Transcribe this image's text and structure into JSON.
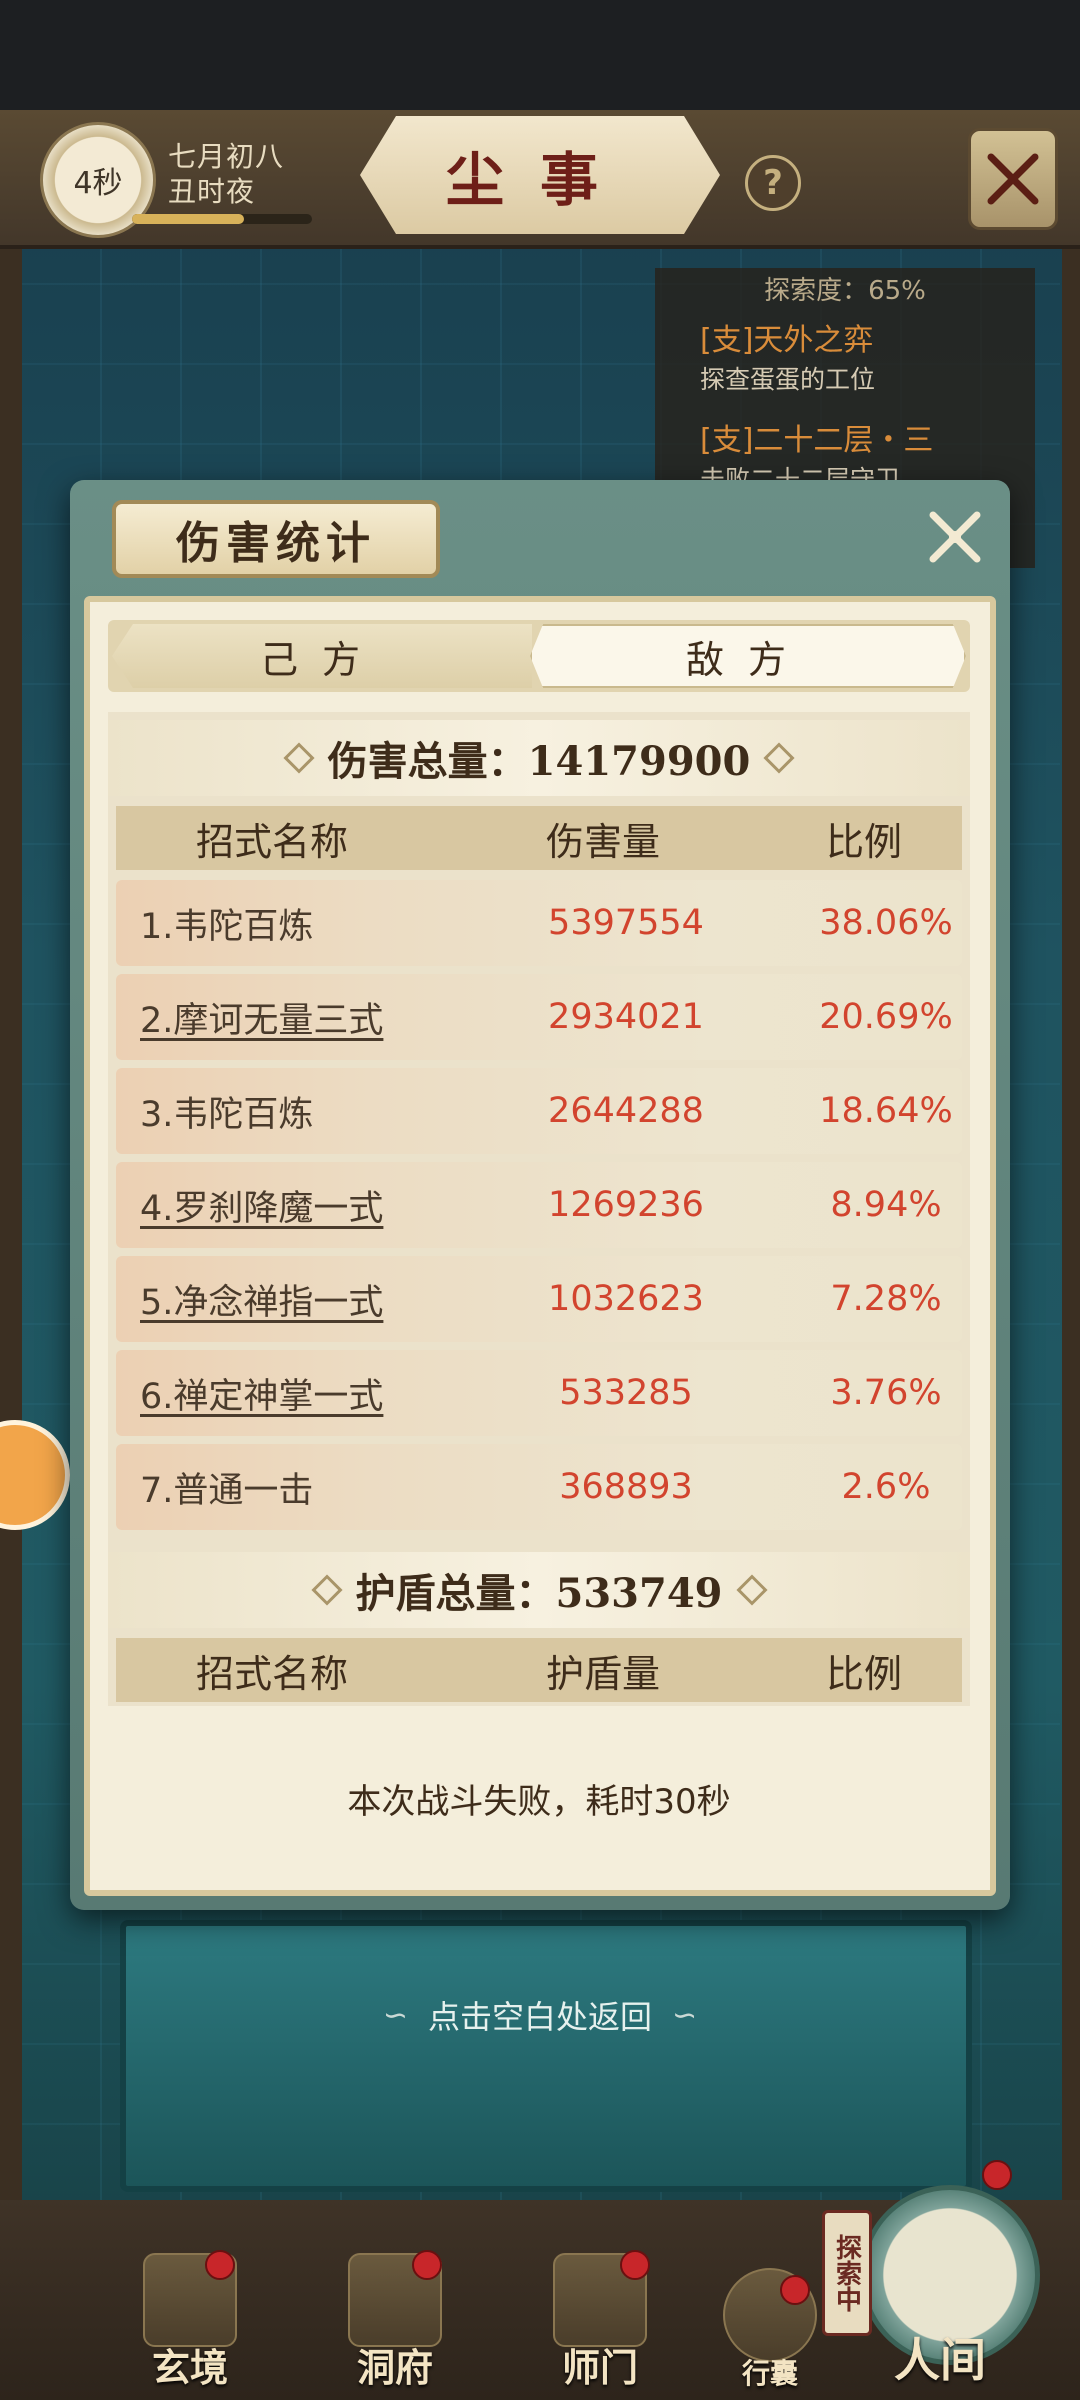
{
  "top_bar": {
    "timer": "4秒",
    "date_line1": "七月初八",
    "date_line2": "丑时夜",
    "progress": 0.62,
    "title": "尘事",
    "help_label": "?"
  },
  "quest_panel": {
    "explore_label": "探索度：65%",
    "quests": [
      {
        "title": "[支]天外之弈",
        "desc": "探查蛋蛋的工位"
      },
      {
        "title": "[支]二十二层・三",
        "desc": "击败二十二层守卫"
      }
    ]
  },
  "dialog": {
    "title": "伤害统计",
    "tabs": [
      {
        "label": "己方",
        "selected": false
      },
      {
        "label": "敌方",
        "selected": true
      }
    ],
    "damage_section": {
      "heading": "伤害总量：14179900",
      "columns": [
        "招式名称",
        "伤害量",
        "比例"
      ],
      "rows": [
        {
          "name": "1.韦陀百炼",
          "damage": "5397554",
          "ratio": "38.06%",
          "link": false
        },
        {
          "name": "2.摩诃无量三式",
          "damage": "2934021",
          "ratio": "20.69%",
          "link": true
        },
        {
          "name": "3.韦陀百炼",
          "damage": "2644288",
          "ratio": "18.64%",
          "link": false
        },
        {
          "name": "4.罗刹降魔一式",
          "damage": "1269236",
          "ratio": "8.94%",
          "link": true
        },
        {
          "name": "5.净念禅指一式",
          "damage": "1032623",
          "ratio": "7.28%",
          "link": true
        },
        {
          "name": "6.禅定神掌一式",
          "damage": "533285",
          "ratio": "3.76%",
          "link": true
        },
        {
          "name": "7.普通一击",
          "damage": "368893",
          "ratio": "2.6%",
          "link": false
        }
      ]
    },
    "shield_section": {
      "heading": "护盾总量：533749",
      "columns": [
        "招式名称",
        "护盾量",
        "比例"
      ]
    },
    "result_text": "本次战斗失败，耗时30秒"
  },
  "return_hint": "点击空白处返回",
  "bottom_nav": {
    "items": [
      {
        "label": "玄境",
        "badge": true
      },
      {
        "label": "洞府",
        "badge": true
      },
      {
        "label": "师门",
        "badge": true
      },
      {
        "label": "行囊",
        "badge": true
      },
      {
        "label": "人间",
        "badge": true
      }
    ],
    "explore_tag": "探索中"
  },
  "colors": {
    "accent_red": "#d2442e",
    "panel_bg": "#f4eedb",
    "frame_green": "#6a8f86"
  }
}
